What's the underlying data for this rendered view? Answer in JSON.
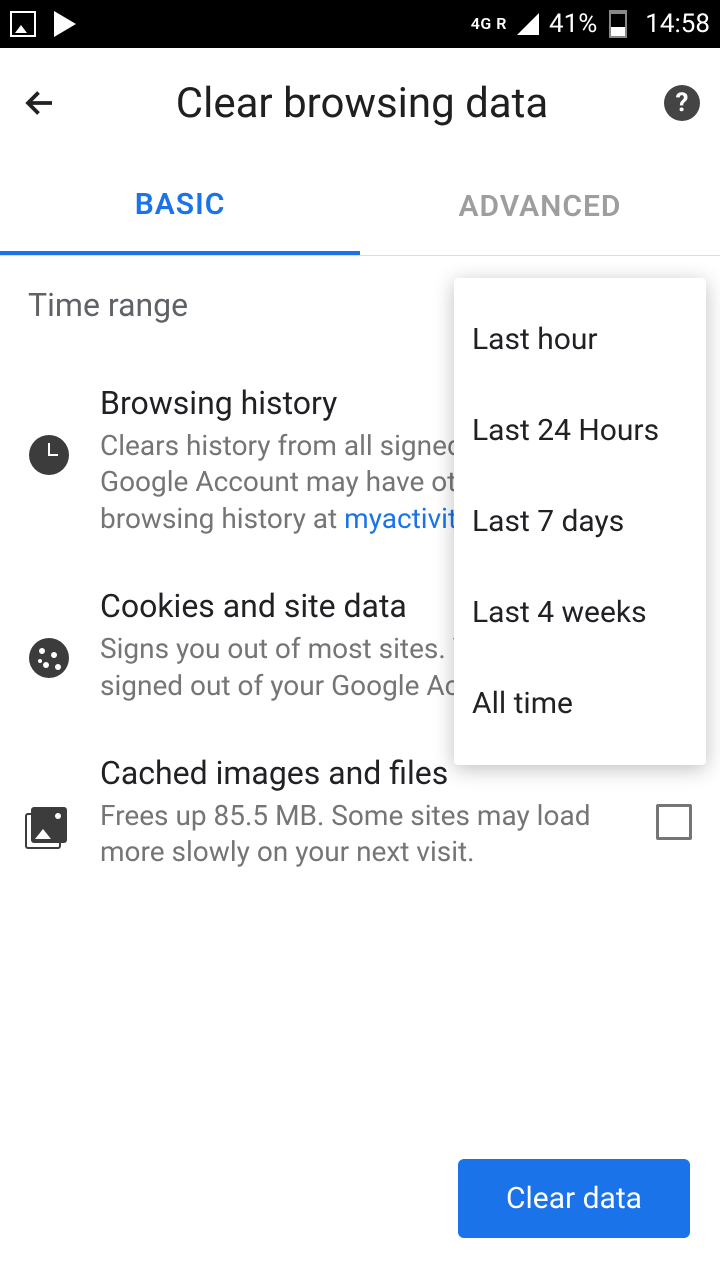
{
  "status_bar": {
    "network": "4G R",
    "battery": "41%",
    "time": "14:58"
  },
  "header": {
    "title": "Clear browsing data"
  },
  "tabs": {
    "basic": "BASIC",
    "advanced": "ADVANCED"
  },
  "time_range_label": "Time range",
  "items": {
    "browsing_history": {
      "title": "Browsing history",
      "desc_before": "Clears history from all signed-in devices. Your Google Account may have other forms of browsing history at ",
      "link": "myactivity.google.com",
      "desc_after": "."
    },
    "cookies": {
      "title": "Cookies and site data",
      "desc": "Signs you out of most sites. You won't be signed out of your Google Account."
    },
    "cache": {
      "title": "Cached images and files",
      "desc": "Frees up 85.5 MB. Some sites may load more slowly on your next visit."
    }
  },
  "dropdown": {
    "options": [
      "Last hour",
      "Last 24 Hours",
      "Last 7 days",
      "Last 4 weeks",
      "All time"
    ]
  },
  "clear_button": "Clear data"
}
